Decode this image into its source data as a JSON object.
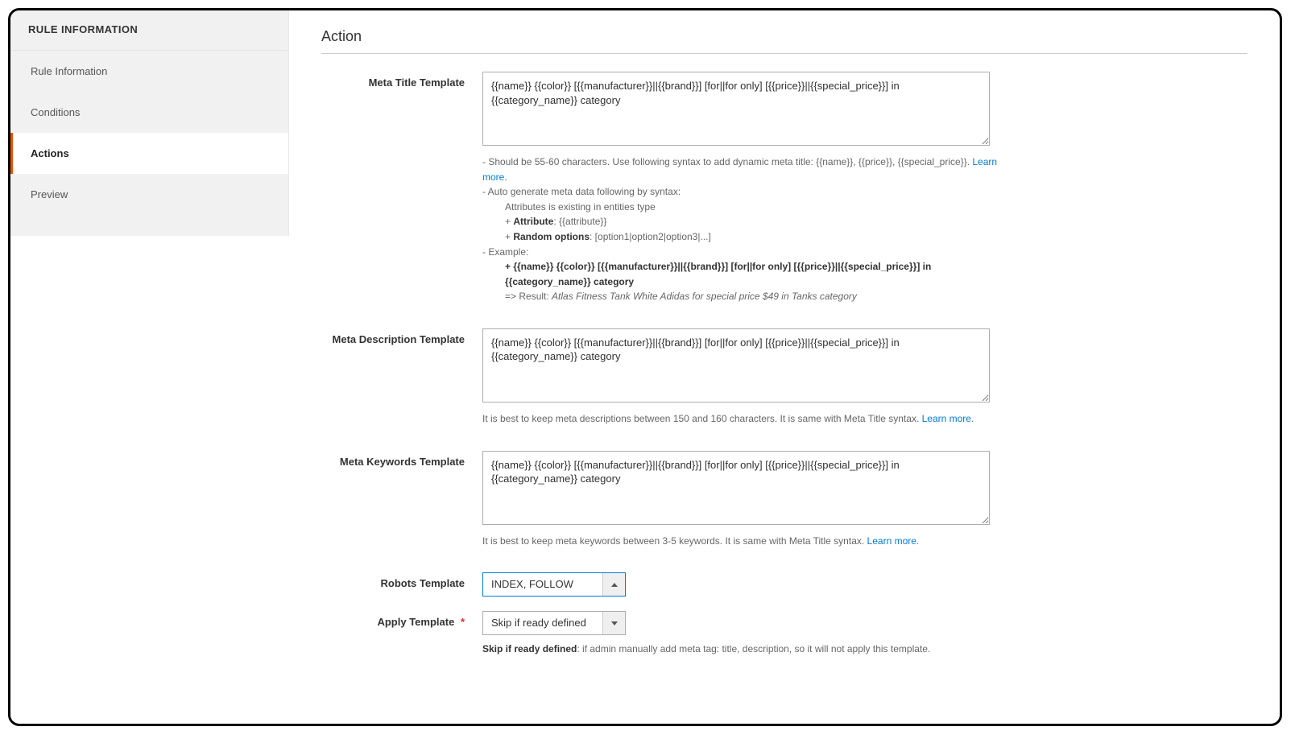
{
  "sidebar": {
    "header": "RULE INFORMATION",
    "items": [
      {
        "label": "Rule Information",
        "active": false
      },
      {
        "label": "Conditions",
        "active": false
      },
      {
        "label": "Actions",
        "active": true
      },
      {
        "label": "Preview",
        "active": false
      }
    ]
  },
  "section": {
    "title": "Action"
  },
  "fields": {
    "meta_title": {
      "label": "Meta Title Template",
      "value": "{{name}} {{color}} [{{manufacturer}}||{{brand}}] [for||for only] [{{price}}||{{special_price}}] in {{category_name}} category",
      "note_line1_prefix": "- Should be 55-60 characters. Use following syntax to add dynamic meta title: {{name}}, {{price}}, {{special_price}}. ",
      "learn_more": "Learn more",
      "note_line2": "- Auto generate meta data following by syntax:",
      "note_line2a": "Attributes is existing in entities type",
      "note_line2b_prefix": "+ ",
      "note_line2b_bold": "Attribute",
      "note_line2b_rest": ": {{attribute}}",
      "note_line2c_prefix": "+ ",
      "note_line2c_bold": "Random options",
      "note_line2c_rest": ": [option1|option2|option3|...]",
      "note_line3": "- Example:",
      "note_ex_bold": "+ {{name}} {{color}} [{{manufacturer}}||{{brand}}] [for||for only] [{{price}}||{{special_price}}] in {{category_name}} category",
      "note_result_prefix": "=> Result: ",
      "note_result_italic": "Atlas Fitness Tank White Adidas for special price $49 in Tanks category"
    },
    "meta_description": {
      "label": "Meta Description Template",
      "value": "{{name}} {{color}} [{{manufacturer}}||{{brand}}] [for||for only] [{{price}}||{{special_price}}] in {{category_name}} category",
      "note_prefix": "It is best to keep meta descriptions between 150 and 160 characters. It is same with Meta Title syntax. ",
      "learn_more": "Learn more"
    },
    "meta_keywords": {
      "label": "Meta Keywords Template",
      "value": "{{name}} {{color}} [{{manufacturer}}||{{brand}}] [for||for only] [{{price}}||{{special_price}}] in {{category_name}} category",
      "note_prefix": "It is best to keep meta keywords between 3-5 keywords. It is same with Meta Title syntax. ",
      "learn_more": "Learn more"
    },
    "robots": {
      "label": "Robots Template",
      "value": "INDEX, FOLLOW"
    },
    "apply": {
      "label": "Apply Template",
      "required_mark": "*",
      "value": "Skip if ready defined",
      "help_bold": "Skip if ready defined",
      "help_rest": ": if admin manually add meta tag: title, description, so it will not apply this template."
    }
  }
}
